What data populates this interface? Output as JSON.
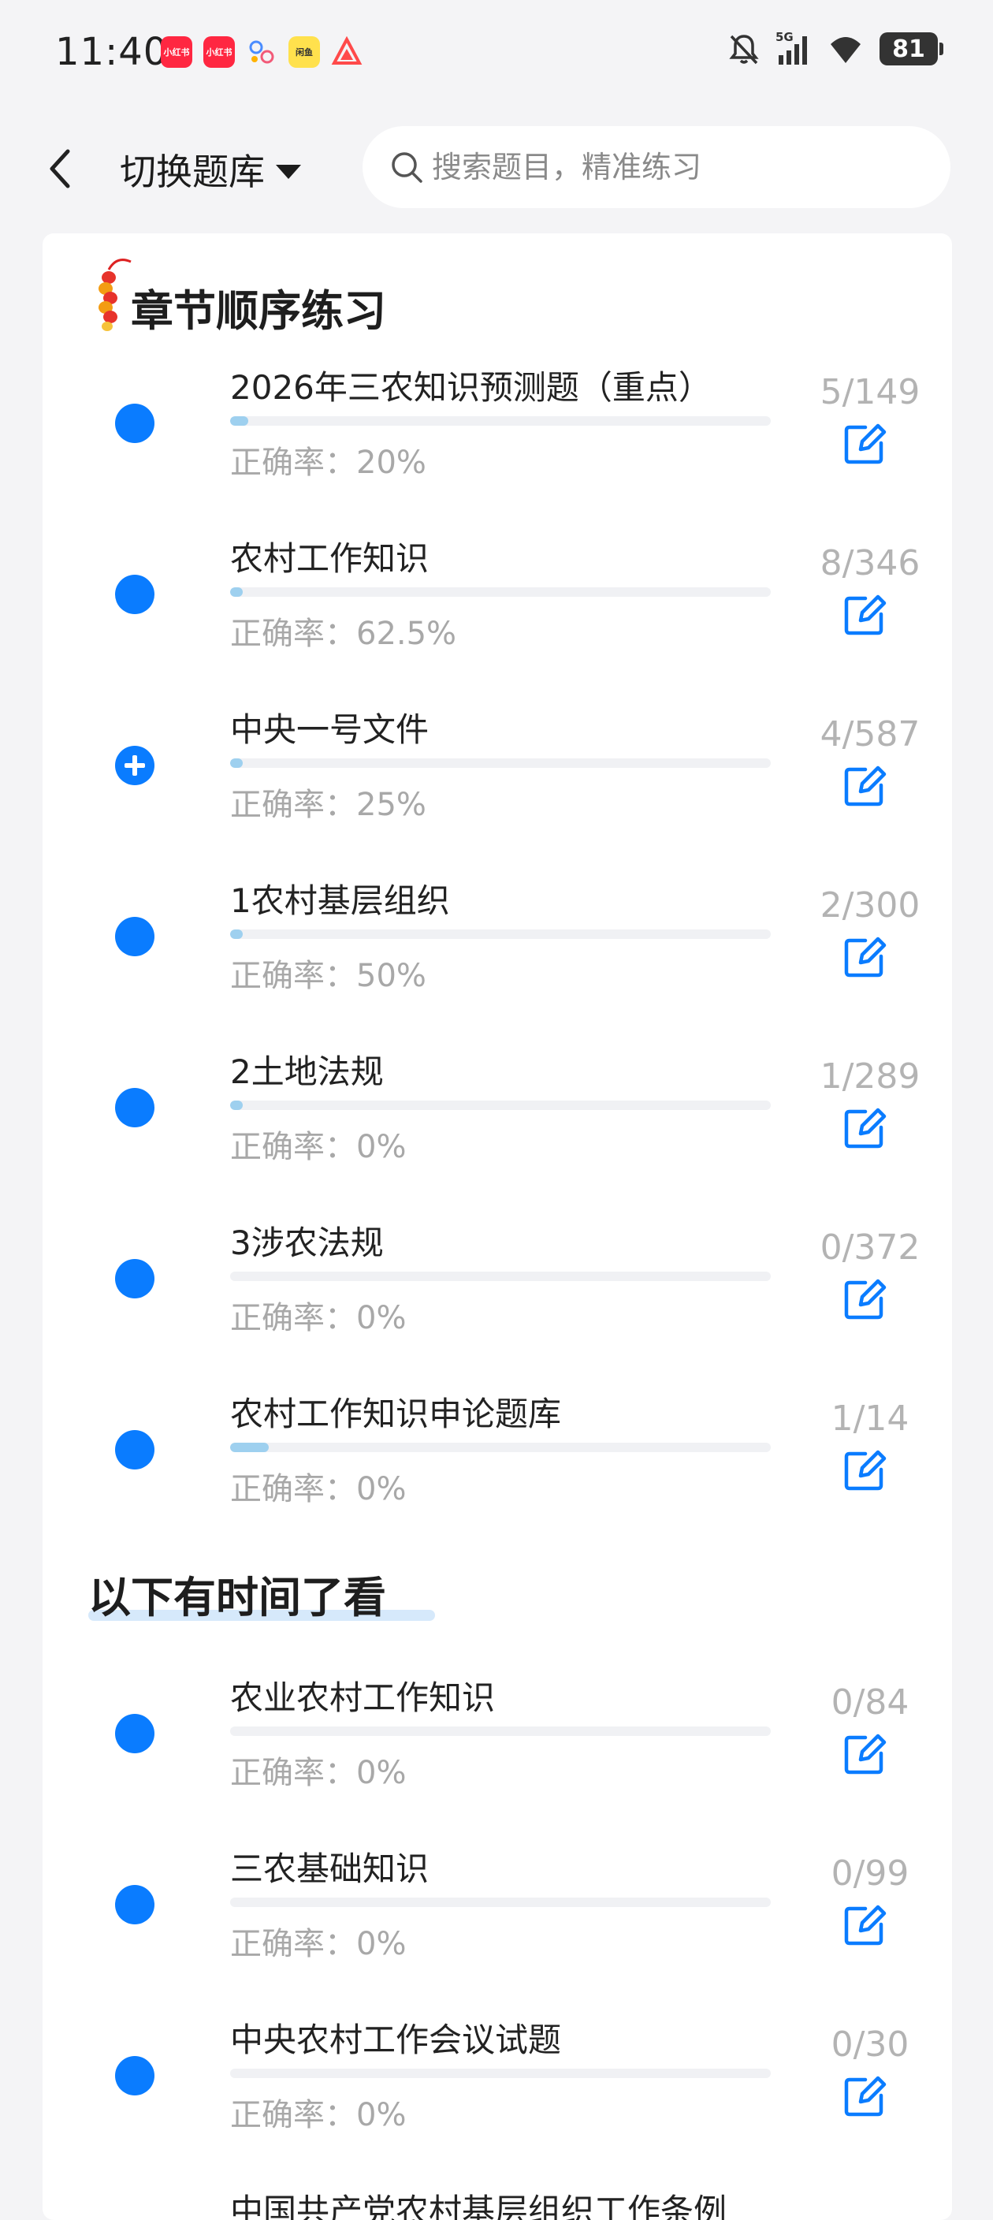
{
  "status_bar": {
    "time": "11:40",
    "notification_icons": [
      {
        "name": "xiaohongshu-app-icon",
        "text": "小红书",
        "color": "#ff2741"
      },
      {
        "name": "xiaohongshu-app-icon-2",
        "text": "小红书",
        "color": "#ff2741"
      },
      {
        "name": "molecule-app-icon",
        "text": "",
        "color": "#ffffff"
      },
      {
        "name": "yellow-app-icon",
        "text": "闲鱼",
        "color": "#ffe14d"
      },
      {
        "name": "triangle-app-icon",
        "text": "",
        "color": "#ffffff"
      }
    ],
    "network": "5G",
    "battery": "81"
  },
  "header": {
    "back_icon": "chevron-left-icon",
    "title": "切换题库",
    "search_placeholder": "搜索题目，精准练习"
  },
  "section1": {
    "title": "章节顺序练习",
    "items": [
      {
        "name": "2026年三农知识预测题（重点）",
        "accuracy": "正确率：20%",
        "count": "5/149",
        "progress": 0.034,
        "icon": "dot"
      },
      {
        "name": "农村工作知识",
        "accuracy": "正确率：62.5%",
        "count": "8/346",
        "progress": 0.023,
        "icon": "dot"
      },
      {
        "name": "中央一号文件",
        "accuracy": "正确率：25%",
        "count": "4/587",
        "progress": 0.007,
        "icon": "plus"
      },
      {
        "name": "1农村基层组织",
        "accuracy": "正确率：50%",
        "count": "2/300",
        "progress": 0.007,
        "icon": "dot"
      },
      {
        "name": "2土地法规",
        "accuracy": "正确率：0%",
        "count": "1/289",
        "progress": 0.003,
        "icon": "dot"
      },
      {
        "name": "3涉农法规",
        "accuracy": "正确率：0%",
        "count": "0/372",
        "progress": 0.0,
        "icon": "dot"
      },
      {
        "name": "农村工作知识申论题库",
        "accuracy": "正确率：0%",
        "count": "1/14",
        "progress": 0.071,
        "icon": "dot"
      }
    ]
  },
  "section2": {
    "title": "以下有时间了看",
    "items": [
      {
        "name": "农业农村工作知识",
        "accuracy": "正确率：0%",
        "count": "0/84",
        "progress": 0.0,
        "icon": "dot"
      },
      {
        "name": "三农基础知识",
        "accuracy": "正确率：0%",
        "count": "0/99",
        "progress": 0.0,
        "icon": "dot"
      },
      {
        "name": "中央农村工作会议试题",
        "accuracy": "正确率：0%",
        "count": "0/30",
        "progress": 0.0,
        "icon": "dot"
      },
      {
        "name": "中国共产党农村基层组织工作条例",
        "accuracy": "",
        "count": "",
        "progress": 0.0,
        "icon": "dot"
      }
    ]
  },
  "colors": {
    "accent": "#0a7cff",
    "progress_fill": "#9ed0ef",
    "count_text": "#b3b3b3"
  }
}
